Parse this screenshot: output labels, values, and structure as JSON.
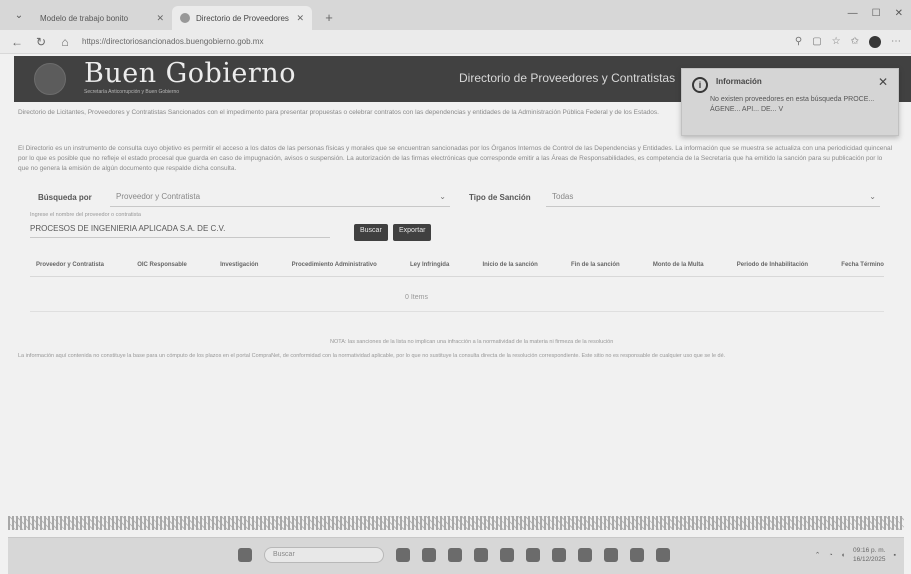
{
  "browser": {
    "tabs": [
      {
        "label": "Modelo de trabajo bonito",
        "active": false
      },
      {
        "label": "Directorio de Proveedores y Con",
        "active": true
      }
    ],
    "url": "https://directoriosancionados.buengobierno.gob.mx"
  },
  "header": {
    "brand": "Buen Gobierno",
    "brand_sub": "Secretaría Anticorrupción y Buen Gobierno",
    "directory_title": "Directorio de Proveedores y Contratistas"
  },
  "notification": {
    "title": "Información",
    "close": "✕",
    "body": "No existen proveedores en esta búsqueda PROCE... ÁGENE... API... DE... V"
  },
  "intro": {
    "line1": "Directorio de Licitantes, Proveedores y Contratistas Sancionados con el impedimento para presentar propuestas o celebrar contratos con las dependencias y entidades de la Administración Pública Federal y de los Estados.",
    "line2": "El Directorio es un instrumento de consulta cuyo objetivo es permitir el acceso a los datos de las personas físicas y morales que se encuentran sancionadas por los Órganos Internos de Control de las Dependencias y Entidades. La información que se muestra se actualiza con una periodicidad quincenal por lo que es posible que no refleje el estado procesal que guarda en caso de impugnación, avisos o suspensión. La autorización de las firmas electrónicas que corresponde emitir a las Áreas de Responsabilidades, es competencia de la Secretaría que ha emitido la sanción para su publicación por lo que no genera la emisión de algún documento que respalde dicha consulta."
  },
  "search": {
    "label": "Búsqueda por",
    "selected": "Proveedor y Contratista",
    "tipo_label": "Tipo de Sanción",
    "tipo_selected": "Todas",
    "hint": "Ingrese el nombre del proveedor o contratista",
    "value": "PROCESOS DE INGENIERIA APLICADA S.A. DE C.V.",
    "buscar": "Buscar",
    "exportar": "Exportar"
  },
  "table": {
    "columns": [
      "Proveedor y Contratista",
      "OIC Responsable",
      "Investigación",
      "Procedimiento Administrativo",
      "Ley Infringida",
      "Inicio de la sanción",
      "Fin de la sanción",
      "Monto de la Multa",
      "Periodo de Inhabilitación",
      "Fecha Término"
    ],
    "empty_text": "0 Items"
  },
  "note": "NOTA: las sanciones de la lista no implican una infracción a la normatividad de la materia ni firmeza de la resolución",
  "footnote": "La información aquí contenida no constituye la base para un cómputo de los plazos en el portal CompraNet, de conformidad con la normatividad aplicable, por lo que no sustituye la consulta directa de la resolución correspondiente. Este sitio no es responsable de cualquier uso que se le dé.",
  "taskbar": {
    "search_placeholder": "Buscar",
    "time": "09:16 p. m.",
    "date": "16/12/2025"
  }
}
